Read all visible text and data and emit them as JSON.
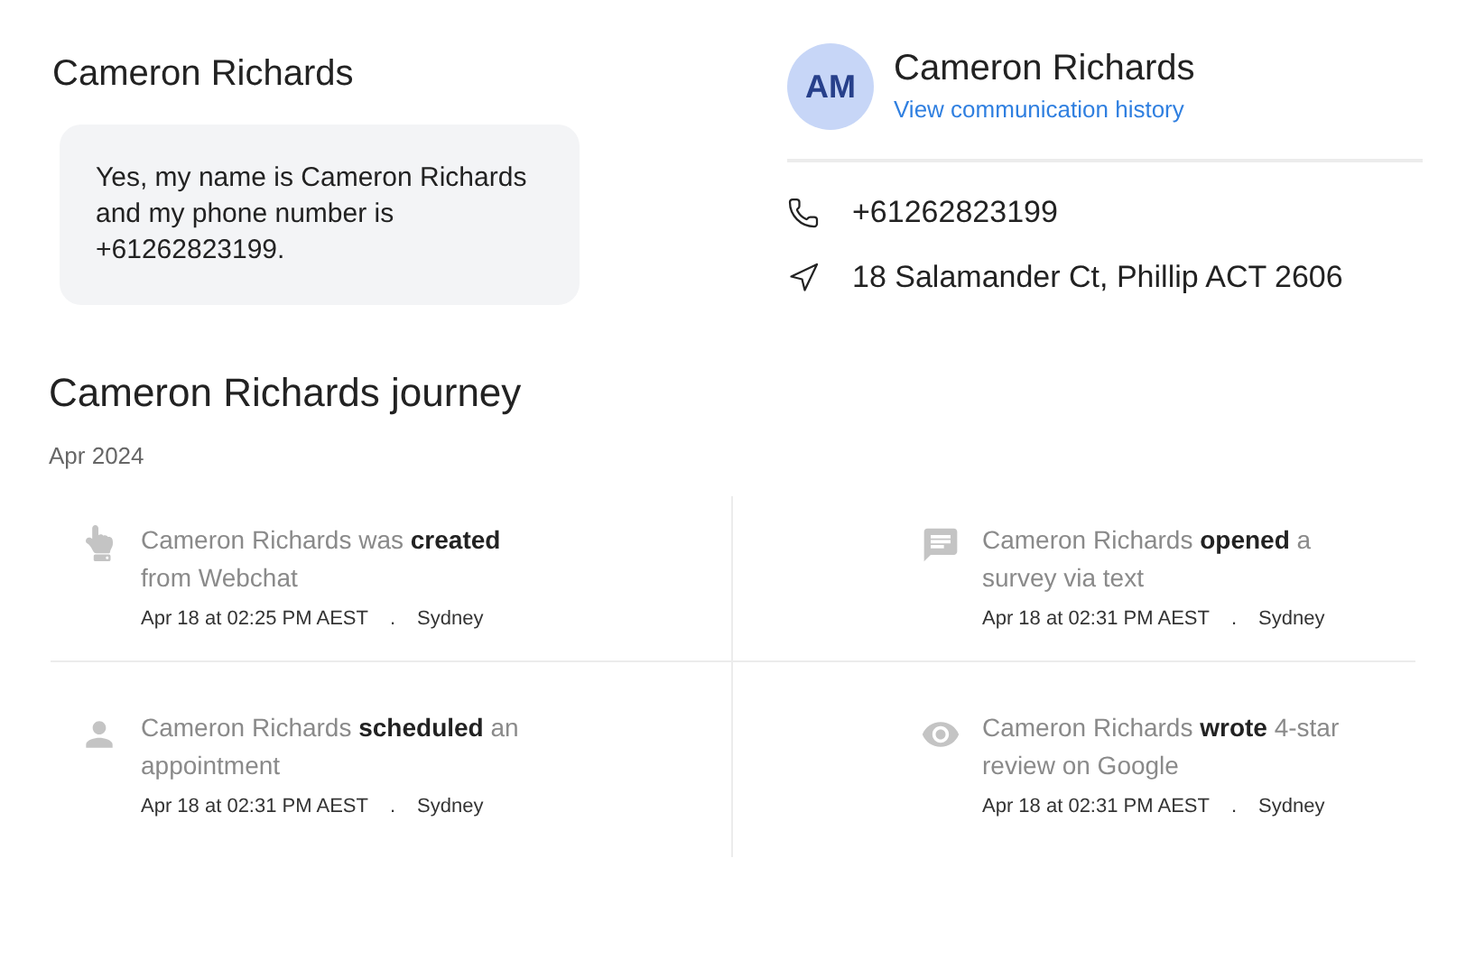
{
  "chat": {
    "sender": "Cameron Richards",
    "message": "Yes, my name is Cameron Richards and my phone number is +61262823199."
  },
  "contact": {
    "initials": "AM",
    "name": "Cameron Richards",
    "link": "View communication history",
    "details": [
      {
        "kind": "phone",
        "text": "+61262823199"
      },
      {
        "kind": "address",
        "text": "18 Salamander Ct, Phillip ACT 2606"
      }
    ]
  },
  "journey": {
    "title": "Cameron Richards journey",
    "period": "Apr 2024",
    "events": [
      {
        "kind": "hand",
        "text": "Cameron Richards was **created** from Webchat",
        "time": "Apr 18 at 02:25 PM AEST",
        "separator": ".",
        "place": "Sydney"
      },
      {
        "kind": "chat",
        "text": "Cameron Richards **opened** a survey via text",
        "time": "Apr 18 at 02:31 PM AEST",
        "separator": ".",
        "place": "Sydney"
      },
      {
        "kind": "person",
        "text": "Cameron Richards **scheduled** an appointment",
        "time": "Apr 18 at 02:31 PM AEST",
        "separator": ".",
        "place": "Sydney"
      },
      {
        "kind": "eye",
        "text": "Cameron Richards **wrote** 4-star review on Google",
        "time": "Apr 18 at 02:31 PM AEST",
        "separator": ".",
        "place": "Sydney"
      }
    ]
  }
}
